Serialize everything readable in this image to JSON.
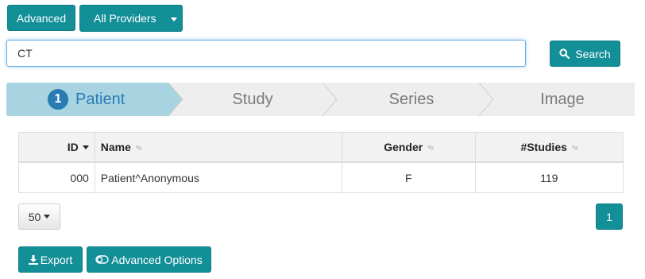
{
  "toolbar": {
    "advanced_label": "Advanced",
    "providers_label": "All Providers"
  },
  "search": {
    "value": "CT",
    "button_label": "Search"
  },
  "steps": [
    {
      "number": "1",
      "label": "Patient",
      "active": true
    },
    {
      "number": "",
      "label": "Study",
      "active": false
    },
    {
      "number": "",
      "label": "Series",
      "active": false
    },
    {
      "number": "",
      "label": "Image",
      "active": false
    }
  ],
  "table": {
    "headers": {
      "id": "ID",
      "name": "Name",
      "gender": "Gender",
      "studies": "#Studies"
    },
    "rows": [
      {
        "id": "000",
        "name": "Patient^Anonymous",
        "gender": "F",
        "studies": "119"
      }
    ]
  },
  "pagination": {
    "page_size": "50",
    "current_page": "1"
  },
  "actions": {
    "export_label": "Export",
    "advanced_options_label": "Advanced Options"
  },
  "colors": {
    "accent": "#138f98",
    "active_step_bg": "#a7d4e0",
    "inactive_step_bg": "#eeeeee",
    "step_number_bg": "#2a7ab3"
  },
  "icons": {
    "search": "search-icon",
    "export": "download-icon",
    "advanced_options": "toggle-icon",
    "sort": "sort-icon"
  }
}
